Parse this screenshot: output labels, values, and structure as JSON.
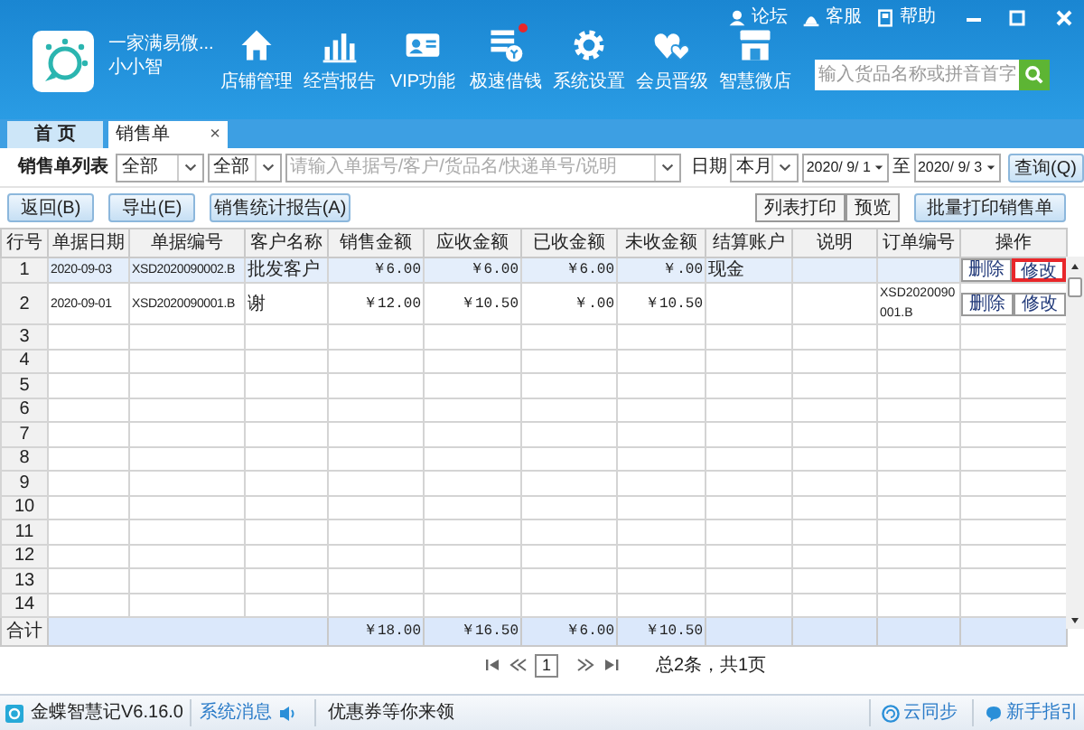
{
  "app": {
    "shop_name": "一家满易微...",
    "user": "小小智"
  },
  "nav": [
    {
      "label": "店铺管理",
      "kind": "home",
      "badge": false
    },
    {
      "label": "经营报告",
      "kind": "chart",
      "badge": false
    },
    {
      "label": "VIP功能",
      "kind": "card",
      "badge": false
    },
    {
      "label": "极速借钱",
      "kind": "loan",
      "badge": true
    },
    {
      "label": "系统设置",
      "kind": "gear",
      "badge": false
    },
    {
      "label": "会员晋级",
      "kind": "hearts",
      "badge": false
    },
    {
      "label": "智慧微店",
      "kind": "shop",
      "badge": false
    }
  ],
  "top_links": [
    {
      "label": "论坛",
      "kind": "forum"
    },
    {
      "label": "客服",
      "kind": "service"
    },
    {
      "label": "帮助",
      "kind": "help"
    }
  ],
  "search": {
    "placeholder": "输入货品名称或拼音首字"
  },
  "tabs": [
    {
      "label": "首 页",
      "selected": false
    },
    {
      "label": "销售单",
      "selected": true,
      "close": "×"
    }
  ],
  "filter": {
    "title": "销售单列表",
    "selects": [
      "全部",
      "全部"
    ],
    "keyword_placeholder": "请输入单据号/客户/货品名/快递单号/说明",
    "date_label": "日期",
    "period": "本月",
    "date_from": "2020/ 9/ 1",
    "to_label": "至",
    "date_to": "2020/ 9/ 3",
    "query_button": "查询(Q)"
  },
  "buttons": [
    "返回(B)",
    "导出(E)",
    "销售统计报告(A)"
  ],
  "print_buttons": [
    "列表打印",
    "预览"
  ],
  "batch_print_button": "批量打印销售单",
  "table": {
    "columns": [
      "行号",
      "单据日期",
      "单据编号",
      "客户名称",
      "销售金额",
      "应收金额",
      "已收金额",
      "未收金额",
      "结算账户",
      "说明",
      "订单编号",
      "操作"
    ],
    "rows": [
      {
        "no": "1",
        "selected": true,
        "date": "2020-09-03",
        "number": "XSD2020090002.B",
        "customer": "批发客户",
        "sales": "￥6.00",
        "receivable": "￥6.00",
        "received": "￥6.00",
        "outstanding": "￥.00",
        "account": "现金",
        "actions": [
          {
            "label": "删除",
            "highlighted": false
          },
          {
            "label": "修改",
            "highlighted": true
          }
        ]
      },
      {
        "no": "2",
        "selected": false,
        "date": "2020-09-01",
        "number": "XSD2020090001.B",
        "customer": "谢",
        "sales": "￥12.00",
        "receivable": "￥10.50",
        "received": "￥.00",
        "outstanding": "￥10.50",
        "order_no": "XSD2020090001.B",
        "actions": [
          {
            "label": "删除",
            "highlighted": false
          },
          {
            "label": "修改",
            "highlighted": false
          }
        ]
      },
      {
        "no": "3",
        "selected": false
      },
      {
        "no": "4",
        "selected": false
      },
      {
        "no": "5",
        "selected": false
      },
      {
        "no": "6",
        "selected": false
      },
      {
        "no": "7",
        "selected": false
      },
      {
        "no": "8",
        "selected": false
      },
      {
        "no": "9",
        "selected": false
      },
      {
        "no": "10",
        "selected": false
      },
      {
        "no": "11",
        "selected": false
      },
      {
        "no": "12",
        "selected": false
      },
      {
        "no": "13",
        "selected": false
      },
      {
        "no": "14",
        "selected": false
      }
    ],
    "total": {
      "label": "合计",
      "sales": "￥18.00",
      "receivable": "￥16.50",
      "received": "￥6.00",
      "outstanding": "￥10.50"
    }
  },
  "pager": {
    "page": "1",
    "summary": "总2条，共1页"
  },
  "status_bar": {
    "version": "金蝶智慧记V6.16.0",
    "messages": "系统消息",
    "promo": "优惠券等你来领",
    "sync": "云同步",
    "guide": "新手指引"
  }
}
